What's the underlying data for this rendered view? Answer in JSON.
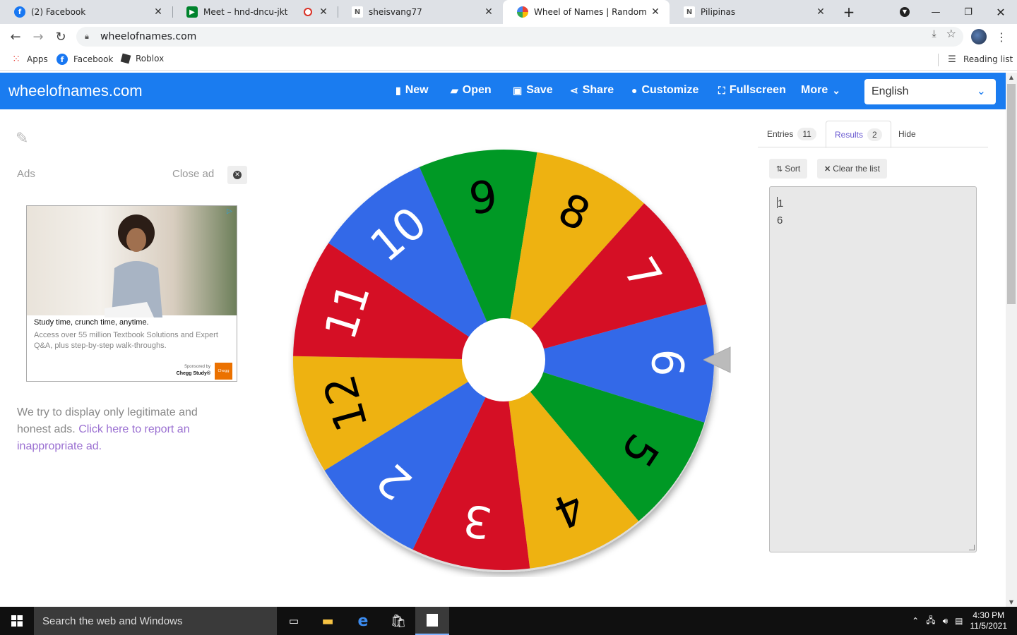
{
  "browser": {
    "tabs": [
      {
        "title": "(2) Facebook",
        "icon": "facebook-icon"
      },
      {
        "title": "Meet – hnd-dncu-jkt",
        "icon": "meet-icon"
      },
      {
        "title": "sheisvang77",
        "icon": "notion-icon"
      },
      {
        "title": "Wheel of Names | Random nam",
        "icon": "google-icon"
      },
      {
        "title": "Pilipinas",
        "icon": "notion-icon"
      }
    ],
    "url": "wheelofnames.com",
    "bookmarks": [
      "Apps",
      "Facebook",
      "Roblox"
    ],
    "reading_list": "Reading list"
  },
  "app": {
    "brand": "wheelofnames.com",
    "nav": {
      "new": "New",
      "open": "Open",
      "save": "Save",
      "share": "Share",
      "customize": "Customize",
      "fullscreen": "Fullscreen",
      "more": "More"
    },
    "language": "English",
    "brand_color": "#1a7cf0"
  },
  "ads": {
    "label": "Ads",
    "close": "Close ad",
    "headline": "Study time, crunch time, anytime.",
    "body": "Access over 55 million Textbook Solutions and Expert Q&A, plus step-by-step walk-throughs.",
    "sponsored": "Sponsored by",
    "sponsor": "Chegg Study®",
    "sponsor_badge": "Chegg",
    "note": "We try to display only legitimate and honest ads.",
    "note_link": "Click here to report an inappropriate ad."
  },
  "wheel": {
    "segments": [
      {
        "label": "6",
        "color": "#3369e8",
        "text_color": "#ffffff"
      },
      {
        "label": "5",
        "color": "#009925",
        "text_color": "#000000"
      },
      {
        "label": "4",
        "color": "#eeb211",
        "text_color": "#000000"
      },
      {
        "label": "3",
        "color": "#d50f25",
        "text_color": "#ffffff"
      },
      {
        "label": "2",
        "color": "#3369e8",
        "text_color": "#ffffff"
      },
      {
        "label": "12",
        "color": "#eeb211",
        "text_color": "#000000"
      },
      {
        "label": "11",
        "color": "#d50f25",
        "text_color": "#ffffff"
      },
      {
        "label": "10",
        "color": "#3369e8",
        "text_color": "#ffffff"
      },
      {
        "label": "9",
        "color": "#009925",
        "text_color": "#000000"
      },
      {
        "label": "8",
        "color": "#eeb211",
        "text_color": "#000000"
      },
      {
        "label": "7",
        "color": "#d50f25",
        "text_color": "#ffffff"
      }
    ]
  },
  "panel": {
    "tab_entries": "Entries",
    "entries_count": "11",
    "tab_results": "Results",
    "results_count": "2",
    "tab_hide": "Hide",
    "sort": "Sort",
    "clear": "Clear the list",
    "results": [
      "1",
      "6"
    ]
  },
  "taskbar": {
    "search": "Search the web and Windows",
    "time": "4:30 PM",
    "date": "11/5/2021"
  }
}
